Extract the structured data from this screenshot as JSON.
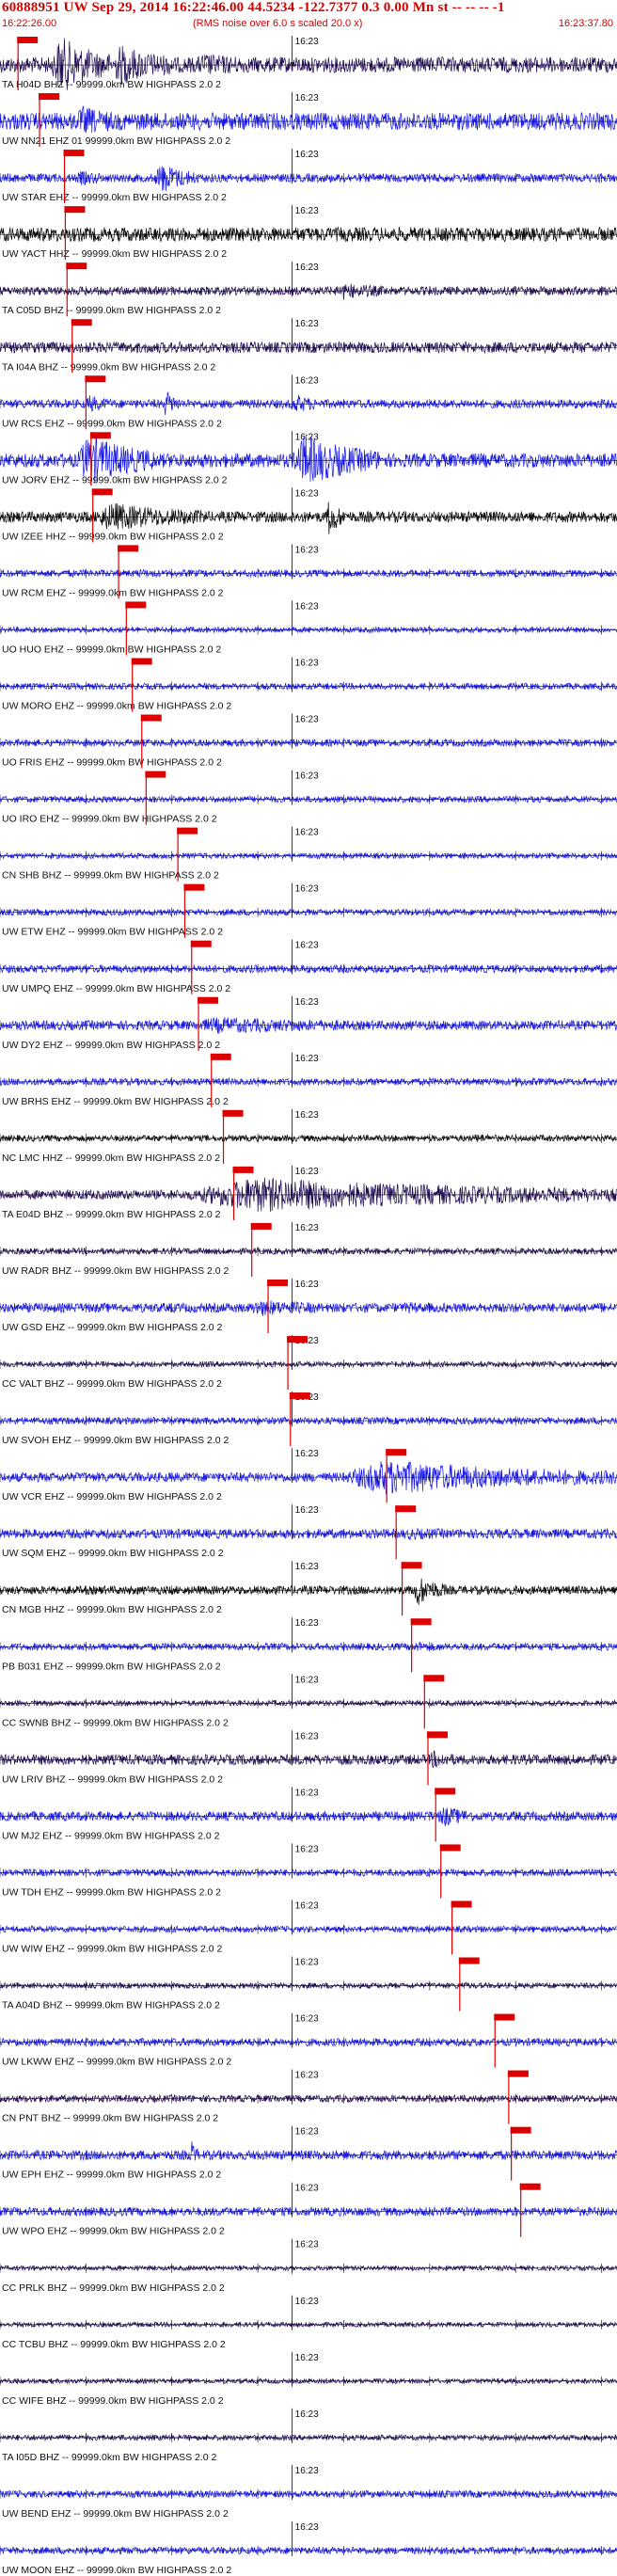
{
  "header": {
    "title": "60888951 UW Sep 29, 2014 16:22:46.00   44.5234 -122.7377   0.3 0.00 Mn st -- -- --  -1",
    "start_time": "16:22:26.00",
    "note": "(RMS noise over 6.0 s scaled 20.0 x)",
    "end_time": "16:23:37.80"
  },
  "colors": {
    "text_red": "#d40000",
    "pick_red": "#dd0000",
    "blue": "#1414e6",
    "dark": "#1e0a50",
    "black": "#000000"
  },
  "chart_data": {
    "type": "line",
    "title": "60888951 UW Sep 29, 2014 16:22:46.00   44.5234 -122.7377   0.3 0.00 Mn st -- -- --  -1",
    "x_unit": "seconds after 16:22:26.00",
    "xlim": [
      0,
      71.8
    ],
    "minute_mark_label": "16:23",
    "minute_mark_seconds": 34,
    "series": [
      {
        "label": "TA H04D BHZ -- 99999.0km BW HIGHPASS 2.0 2",
        "color": "dark",
        "pick_seconds": 2.1,
        "amplitude": 1.0,
        "events": [
          [
            6,
            13,
            3.0
          ],
          [
            13,
            20,
            2.2
          ],
          [
            23,
            28,
            1.4
          ],
          [
            36,
            41,
            0.9
          ]
        ]
      },
      {
        "label": "UW NN21 EHZ 01 99999.0km BW HIGHPASS 2.0 2",
        "color": "blue",
        "pick_seconds": 4.6,
        "amplitude": 1.1,
        "events": [
          [
            9,
            13,
            1.6
          ]
        ]
      },
      {
        "label": "UW STAR EHZ -- 99999.0km BW HIGHPASS 2.0 2",
        "color": "blue",
        "pick_seconds": 7.5,
        "amplitude": 0.55,
        "events": [
          [
            9,
            12,
            1.6
          ],
          [
            18,
            23,
            3.0
          ]
        ]
      },
      {
        "label": "UW YACT HHZ -- 99999.0km BW HIGHPASS 2.0 2",
        "color": "black",
        "pick_seconds": 7.6,
        "amplitude": 0.9,
        "events": []
      },
      {
        "label": "TA C05D BHZ -- 99999.0km BW HIGHPASS 2.0 2",
        "color": "dark",
        "pick_seconds": 7.8,
        "amplitude": 0.55,
        "events": [
          [
            39,
            45,
            1.8
          ]
        ]
      },
      {
        "label": "TA I04A BHZ -- 99999.0km BW HIGHPASS 2.0 2",
        "color": "dark",
        "pick_seconds": 8.4,
        "amplitude": 0.7,
        "events": []
      },
      {
        "label": "UW RCS EHZ -- 99999.0km BW HIGHPASS 2.0 2",
        "color": "blue",
        "pick_seconds": 10.0,
        "amplitude": 0.55,
        "events": [
          [
            10,
            13,
            1.8
          ],
          [
            19,
            21,
            2.6
          ],
          [
            34,
            37,
            2.0
          ]
        ]
      },
      {
        "label": "UW JORV EHZ -- 99999.0km BW HIGHPASS 2.0 2",
        "color": "blue",
        "pick_seconds": 10.6,
        "amplitude": 0.9,
        "events": [
          [
            9,
            18,
            3.0
          ],
          [
            34,
            44,
            3.0
          ]
        ]
      },
      {
        "label": "UW IZEE HHZ -- 99999.0km BW HIGHPASS 2.0 2",
        "color": "black",
        "pick_seconds": 10.8,
        "amplitude": 0.7,
        "events": [
          [
            11,
            24,
            2.2
          ],
          [
            38,
            40,
            3.0
          ]
        ]
      },
      {
        "label": "UW RCM EHZ -- 99999.0km BW HIGHPASS 2.0 2",
        "color": "blue",
        "pick_seconds": 13.8,
        "amplitude": 0.45,
        "events": [
          [
            16,
            18,
            1.2
          ]
        ]
      },
      {
        "label": "UO HUO EHZ -- 99999.0km BW HIGHPASS 2.0 2",
        "color": "blue",
        "pick_seconds": 14.7,
        "amplitude": 0.35,
        "events": [
          [
            0,
            72,
            0.3
          ]
        ]
      },
      {
        "label": "UW MORO EHZ -- 99999.0km BW HIGHPASS 2.0 2",
        "color": "blue",
        "pick_seconds": 15.4,
        "amplitude": 0.4,
        "events": []
      },
      {
        "label": "UO FRIS EHZ -- 99999.0km BW HIGHPASS 2.0 2",
        "color": "blue",
        "pick_seconds": 16.5,
        "amplitude": 0.45,
        "events": []
      },
      {
        "label": "UO IRO EHZ -- 99999.0km BW HIGHPASS 2.0 2",
        "color": "blue",
        "pick_seconds": 17.0,
        "amplitude": 0.4,
        "events": []
      },
      {
        "label": "CN SHB BHZ -- 99999.0km BW HIGHPASS 2.0 2",
        "color": "blue",
        "pick_seconds": 20.7,
        "amplitude": 0.35,
        "events": []
      },
      {
        "label": "UW ETW EHZ -- 99999.0km BW HIGHPASS 2.0 2",
        "color": "blue",
        "pick_seconds": 21.5,
        "amplitude": 0.4,
        "events": [
          [
            31,
            33,
            1.2
          ]
        ]
      },
      {
        "label": "UW UMPQ EHZ -- 99999.0km BW HIGHPASS 2.0 2",
        "color": "blue",
        "pick_seconds": 22.3,
        "amplitude": 0.5,
        "events": []
      },
      {
        "label": "UW DY2 EHZ -- 99999.0km BW HIGHPASS 2.0 2",
        "color": "blue",
        "pick_seconds": 23.1,
        "amplitude": 0.6,
        "events": [
          [
            23,
            40,
            1.6
          ]
        ]
      },
      {
        "label": "UW BRHS EHZ -- 99999.0km BW HIGHPASS 2.0 2",
        "color": "blue",
        "pick_seconds": 24.6,
        "amplitude": 0.45,
        "events": [
          [
            60,
            62,
            1.4
          ]
        ]
      },
      {
        "label": "NC LMC HHZ -- 99999.0km BW HIGHPASS 2.0 2",
        "color": "black",
        "pick_seconds": 26.0,
        "amplitude": 0.4,
        "events": [
          [
            55,
            58,
            1.4
          ]
        ]
      },
      {
        "label": "TA E04D BHZ -- 99999.0km BW HIGHPASS 2.0 2",
        "color": "dark",
        "pick_seconds": 27.2,
        "amplitude": 0.6,
        "events": [
          [
            22,
            72,
            3.0
          ]
        ]
      },
      {
        "label": "UW RADR BHZ -- 99999.0km BW HIGHPASS 2.0 2",
        "color": "dark",
        "pick_seconds": 29.3,
        "amplitude": 0.4,
        "events": []
      },
      {
        "label": "UW GSD EHZ -- 99999.0km BW HIGHPASS 2.0 2",
        "color": "blue",
        "pick_seconds": 31.2,
        "amplitude": 0.6,
        "events": [
          [
            29,
            37,
            1.6
          ],
          [
            47,
            50,
            1.2
          ]
        ]
      },
      {
        "label": "CC VALT BHZ -- 99999.0km BW HIGHPASS 2.0 2",
        "color": "dark",
        "pick_seconds": 33.5,
        "amplitude": 0.35,
        "events": []
      },
      {
        "label": "UW SVOH EHZ -- 99999.0km BW HIGHPASS 2.0 2",
        "color": "blue",
        "pick_seconds": 33.8,
        "amplitude": 0.45,
        "events": []
      },
      {
        "label": "UW VCR EHZ -- 99999.0km BW HIGHPASS 2.0 2",
        "color": "blue",
        "pick_seconds": 45.0,
        "amplitude": 0.6,
        "events": [
          [
            40,
            72,
            3.0
          ]
        ]
      },
      {
        "label": "UW SQM EHZ -- 99999.0km BW HIGHPASS 2.0 2",
        "color": "blue",
        "pick_seconds": 46.1,
        "amplitude": 0.6,
        "events": [
          [
            47,
            52,
            1.2
          ]
        ]
      },
      {
        "label": "CN MGB HHZ -- 99999.0km BW HIGHPASS 2.0 2",
        "color": "black",
        "pick_seconds": 46.8,
        "amplitude": 0.55,
        "events": [
          [
            48,
            52,
            3.0
          ]
        ]
      },
      {
        "label": "PB B031 EHZ -- 99999.0km BW HIGHPASS 2.0 2",
        "color": "blue",
        "pick_seconds": 47.9,
        "amplitude": 0.45,
        "events": [
          [
            48,
            52,
            1.4
          ]
        ]
      },
      {
        "label": "CC SWNB BHZ -- 99999.0km BW HIGHPASS 2.0 2",
        "color": "dark",
        "pick_seconds": 49.4,
        "amplitude": 0.35,
        "events": []
      },
      {
        "label": "UW LRIV BHZ -- 99999.0km BW HIGHPASS 2.0 2",
        "color": "dark",
        "pick_seconds": 49.8,
        "amplitude": 0.65,
        "events": [
          [
            50,
            53,
            1.6
          ]
        ]
      },
      {
        "label": "UW MJ2 EHZ -- 99999.0km BW HIGHPASS 2.0 2",
        "color": "blue",
        "pick_seconds": 50.7,
        "amplitude": 0.6,
        "events": [
          [
            51,
            55,
            2.0
          ]
        ]
      },
      {
        "label": "UW TDH EHZ -- 99999.0km BW HIGHPASS 2.0 2",
        "color": "blue",
        "pick_seconds": 51.3,
        "amplitude": 0.45,
        "events": []
      },
      {
        "label": "UW WIW EHZ -- 99999.0km BW HIGHPASS 2.0 2",
        "color": "blue",
        "pick_seconds": 52.6,
        "amplitude": 0.4,
        "events": []
      },
      {
        "label": "TA A04D BHZ -- 99999.0km BW HIGHPASS 2.0 2",
        "color": "dark",
        "pick_seconds": 53.5,
        "amplitude": 0.35,
        "events": [
          [
            53,
            55,
            1.4
          ]
        ]
      },
      {
        "label": "UW LKWW EHZ -- 99999.0km BW HIGHPASS 2.0 2",
        "color": "blue",
        "pick_seconds": 57.6,
        "amplitude": 0.5,
        "events": []
      },
      {
        "label": "CN PNT BHZ -- 99999.0km BW HIGHPASS 2.0 2",
        "color": "dark",
        "pick_seconds": 59.2,
        "amplitude": 0.45,
        "events": []
      },
      {
        "label": "UW EPH EHZ -- 99999.0km BW HIGHPASS 2.0 2",
        "color": "blue",
        "pick_seconds": 59.5,
        "amplitude": 0.6,
        "events": [
          [
            22,
            23,
            3.0
          ]
        ]
      },
      {
        "label": "UW WPO EHZ -- 99999.0km BW HIGHPASS 2.0 2",
        "color": "blue",
        "pick_seconds": 60.6,
        "amplitude": 0.55,
        "events": []
      },
      {
        "label": "CC PRLK BHZ -- 99999.0km BW HIGHPASS 2.0 2",
        "color": "dark",
        "pick_seconds": null,
        "amplitude": 0.3,
        "events": []
      },
      {
        "label": "CC TCBU BHZ -- 99999.0km BW HIGHPASS 2.0 2",
        "color": "dark",
        "pick_seconds": null,
        "amplitude": 0.3,
        "events": []
      },
      {
        "label": "CC WIFE BHZ -- 99999.0km BW HIGHPASS 2.0 2",
        "color": "dark",
        "pick_seconds": null,
        "amplitude": 0.3,
        "events": []
      },
      {
        "label": "TA I05D BHZ -- 99999.0km BW HIGHPASS 2.0 2",
        "color": "dark",
        "pick_seconds": null,
        "amplitude": 0.35,
        "events": []
      },
      {
        "label": "UW BEND EHZ -- 99999.0km BW HIGHPASS 2.0 2",
        "color": "blue",
        "pick_seconds": null,
        "amplitude": 0.45,
        "events": []
      },
      {
        "label": "UW MOON EHZ -- 99999.0km BW HIGHPASS 2.0 2",
        "color": "blue",
        "pick_seconds": null,
        "amplitude": 0.45,
        "events": []
      }
    ]
  }
}
